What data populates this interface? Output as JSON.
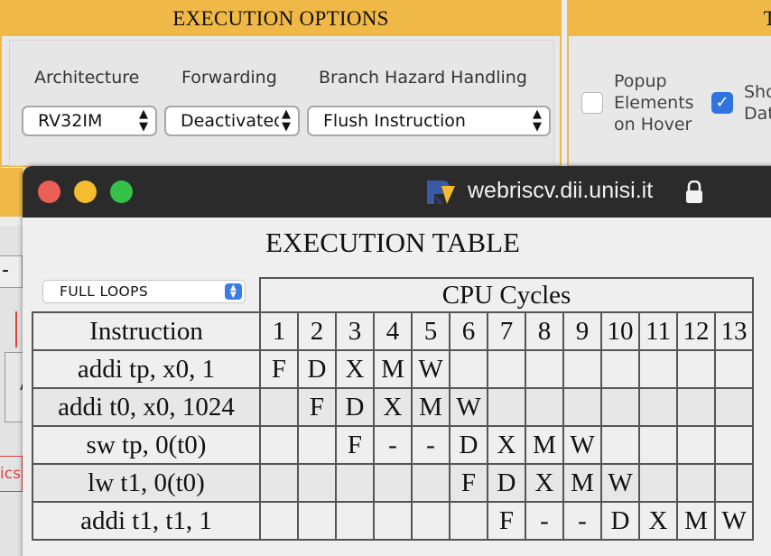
{
  "background": {
    "panel_title": "EXECUTION OPTIONS",
    "architecture_label": "Architecture",
    "forwarding_label": "Forwarding",
    "branch_label": "Branch Hazard Handling",
    "architecture_value": "RV32IM",
    "forwarding_value": "Deactivated",
    "branch_value": "Flush Instruction",
    "popup_label_1": "Popup",
    "popup_label_2": "Elements",
    "popup_label_3": "on Hover",
    "show_label_1": "Sho",
    "show_label_2": "Dat",
    "side_header_fragment": "T",
    "left_fragment_a": "-",
    "left_fragment_b": "A",
    "left_fragment_c": "ics"
  },
  "window": {
    "url": "webriscv.dii.unisi.it",
    "title": "EXECUTION TABLE",
    "loops_select": "FULL LOOPS",
    "cpu_cycles_header": "CPU Cycles",
    "instruction_header": "Instruction",
    "cycles": [
      "1",
      "2",
      "3",
      "4",
      "5",
      "6",
      "7",
      "8",
      "9",
      "10",
      "11",
      "12",
      "13"
    ],
    "rows": [
      {
        "instr": "addi tp, x0, 1",
        "cells": [
          "F",
          "D",
          "X",
          "M",
          "W",
          "",
          "",
          "",
          "",
          "",
          "",
          "",
          ""
        ]
      },
      {
        "instr": "addi t0, x0, 1024",
        "cells": [
          "",
          "F",
          "D",
          "X",
          "M",
          "W",
          "",
          "",
          "",
          "",
          "",
          "",
          ""
        ]
      },
      {
        "instr": "sw tp, 0(t0)",
        "cells": [
          "",
          "",
          "F",
          "-",
          "-",
          "D",
          "X",
          "M",
          "W",
          "",
          "",
          "",
          ""
        ]
      },
      {
        "instr": "lw t1, 0(t0)",
        "cells": [
          "",
          "",
          "",
          "",
          "",
          "F",
          "D",
          "X",
          "M",
          "W",
          "",
          "",
          ""
        ]
      },
      {
        "instr": "addi t1, t1, 1",
        "cells": [
          "",
          "",
          "",
          "",
          "",
          "",
          "F",
          "-",
          "-",
          "D",
          "X",
          "M",
          "W"
        ]
      }
    ]
  },
  "colors": {
    "accent_yellow": "#f0b847",
    "titlebar": "#2b2b2b",
    "checkbox_blue": "#2f74e0"
  }
}
